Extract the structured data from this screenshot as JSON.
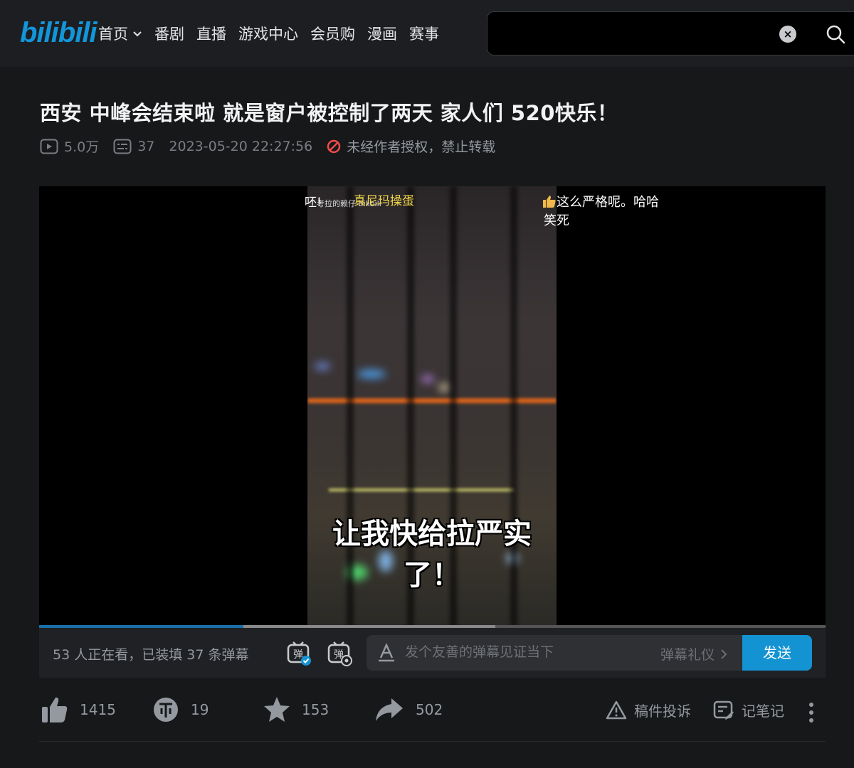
{
  "header": {
    "logo": "bilibili",
    "nav": [
      "首页",
      "番剧",
      "直播",
      "游戏中心",
      "会员购",
      "漫画",
      "赛事"
    ],
    "search_value": ""
  },
  "video": {
    "title": "西安 中峰会结束啦 就是窗户被控制了两天 家人们 520快乐！",
    "views": "5.0万",
    "danmaku_count": "37",
    "date": "2023-05-20 22:27:56",
    "copyright": "未经作者授权，禁止转载"
  },
  "player": {
    "subtitle": "让我快给拉严实了！",
    "watermark_a": "呸!",
    "watermark_b": "考拉的赖仔 bilibili",
    "danmaku": [
      {
        "text": "真尼玛操蛋",
        "color": "#f0d64a"
      },
      {
        "text": "这么严格呢。哈哈",
        "color": "#ffffff"
      },
      {
        "text": "笑死",
        "color": "#ffffff"
      }
    ],
    "progress_played": 0.26,
    "progress_buffered": 0.58
  },
  "danmaku_bar": {
    "viewers": "53 人正在看，已装填 37 条弹幕",
    "placeholder": "发个友善的弹幕见证当下",
    "etiquette": "弹幕礼仪",
    "send": "发送"
  },
  "actions": {
    "likes": "1415",
    "coins": "19",
    "favorites": "153",
    "shares": "502",
    "report": "稿件投诉",
    "notes": "记笔记"
  },
  "colors": {
    "accent": "#1493d3",
    "logo": "#1296db",
    "background": "#17181a"
  }
}
